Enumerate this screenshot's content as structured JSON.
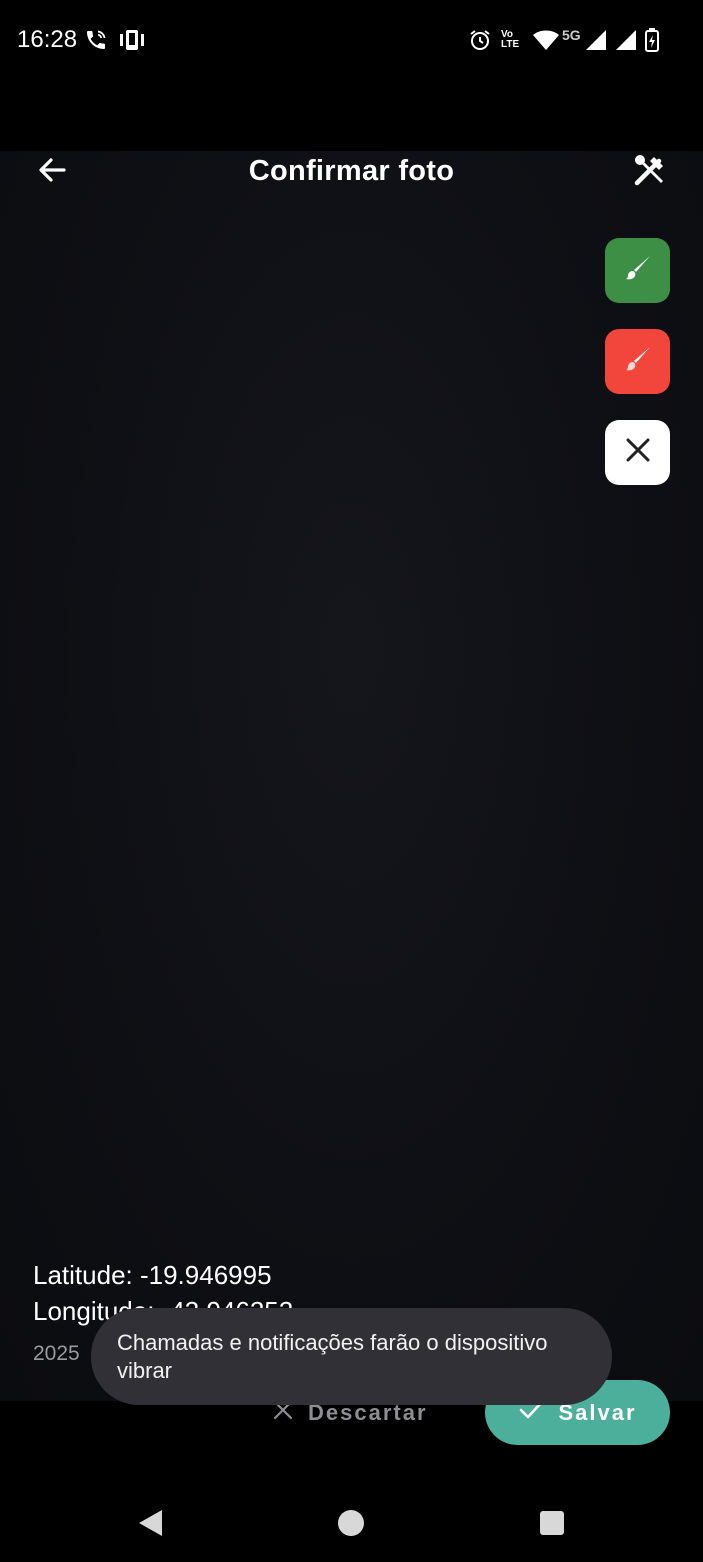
{
  "status_bar": {
    "time": "16:28",
    "network_label": "5G",
    "volte_label": "Vo LTE",
    "icons": [
      "wifi-call-icon",
      "vibrate-icon",
      "alarm-icon",
      "volte-icon",
      "wifi-icon",
      "signal-icon",
      "signal-icon",
      "battery-charging-icon"
    ]
  },
  "app_bar": {
    "title": "Confirmar foto",
    "back_icon": "arrow-left-icon",
    "tools_icon": "tools-icon"
  },
  "side_tools": [
    {
      "name": "green-brush",
      "icon": "brush-icon",
      "color": "#3d8f45"
    },
    {
      "name": "red-brush",
      "icon": "brush-icon",
      "color": "#f2453c"
    },
    {
      "name": "close",
      "icon": "close-icon",
      "color": "#ffffff"
    }
  ],
  "overlay": {
    "latitude": "Latitude: -19.946995",
    "longitude": "Longitude: -43.946252",
    "date_prefix": "2025"
  },
  "toast": {
    "message": "Chamadas e notificações farão o dispositivo vibrar"
  },
  "actions": {
    "discard_label": "Descartar",
    "save_label": "Salvar",
    "accent": "#4caf9b"
  },
  "nav_bar": {
    "icons": [
      "back-triangle-icon",
      "home-circle-icon",
      "recents-square-icon"
    ]
  }
}
